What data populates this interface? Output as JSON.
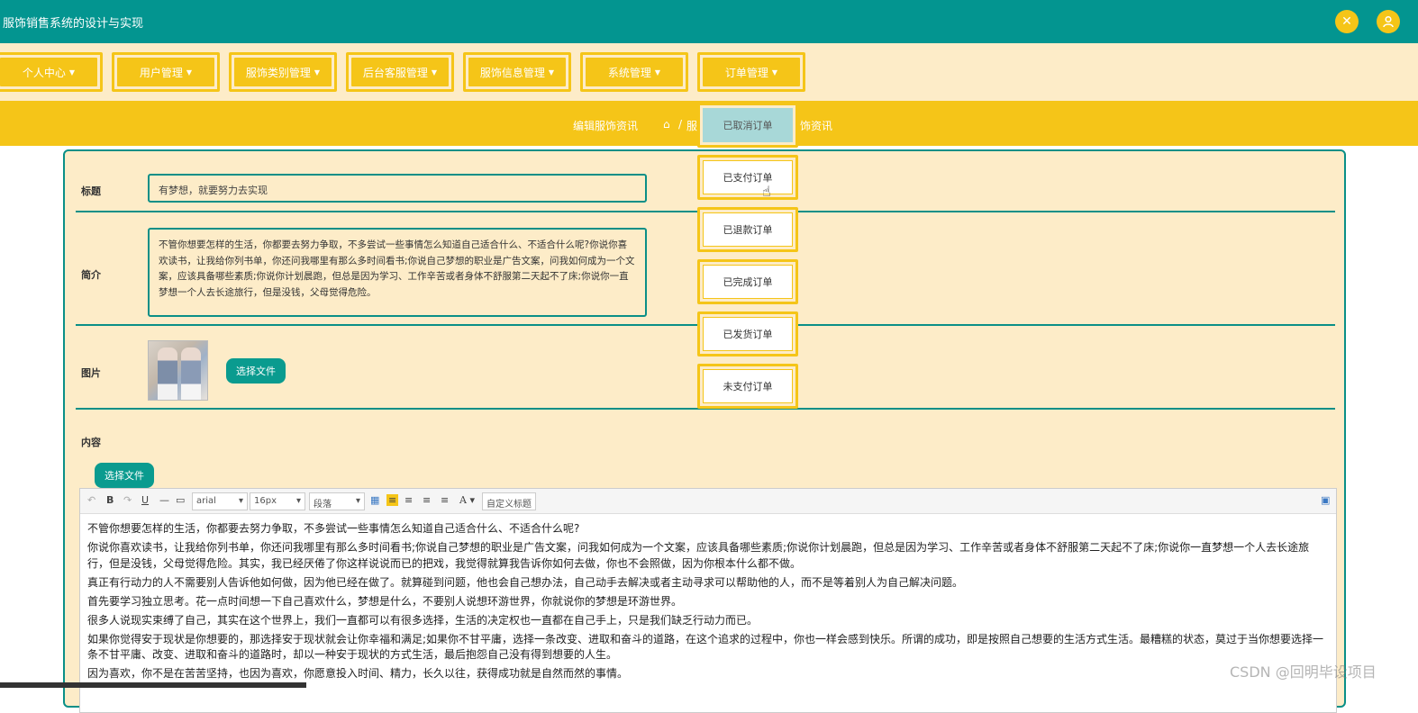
{
  "header": {
    "title": "服饰销售系统的设计与实现",
    "fullscreen_icon": "close-icon",
    "user_icon": "user-icon"
  },
  "nav": {
    "items": [
      {
        "label": "个人中心"
      },
      {
        "label": "用户管理"
      },
      {
        "label": "服饰类别管理"
      },
      {
        "label": "后台客服管理"
      },
      {
        "label": "服饰信息管理"
      },
      {
        "label": "系统管理"
      },
      {
        "label": "订单管理"
      }
    ],
    "order_menu": {
      "items": [
        {
          "label": "已取消订单"
        },
        {
          "label": "已支付订单"
        },
        {
          "label": "已退款订单"
        },
        {
          "label": "已完成订单"
        },
        {
          "label": "已发货订单"
        },
        {
          "label": "未支付订单"
        }
      ]
    }
  },
  "breadcrumb": {
    "page": "编辑服饰资讯",
    "home_icon": "home-icon",
    "sep": "/",
    "path_1": "服",
    "path_2": "饰资讯"
  },
  "form": {
    "title_label": "标题",
    "title_value": "有梦想，就要努力去实现",
    "intro_label": "简介",
    "intro_value": "不管你想要怎样的生活，你都要去努力争取，不多尝试一些事情怎么知道自己适合什么、不适合什么呢?你说你喜欢读书，让我给你列书单，你还问我哪里有那么多时间看书;你说自己梦想的职业是广告文案，问我如何成为一个文案，应该具备哪些素质;你说你计划晨跑，但总是因为学习、工作辛苦或者身体不舒服第二天起不了床;你说你一直梦想一个人去长途旅行，但是没钱，父母觉得危险。",
    "image_label": "图片",
    "choose_file": "选择文件",
    "content_label": "内容",
    "content_choose_file": "选择文件"
  },
  "editor": {
    "font": "arial",
    "size": "16px",
    "para": "段落",
    "custom_title": "自定义标题",
    "paragraphs": [
      "不管你想要怎样的生活，你都要去努力争取，不多尝试一些事情怎么知道自己适合什么、不适合什么呢?",
      "你说你喜欢读书，让我给你列书单，你还问我哪里有那么多时间看书;你说自己梦想的职业是广告文案，问我如何成为一个文案，应该具备哪些素质;你说你计划晨跑，但总是因为学习、工作辛苦或者身体不舒服第二天起不了床;你说你一直梦想一个人去长途旅行，但是没钱，父母觉得危险。其实，我已经厌倦了你这样说说而已的把戏，我觉得就算我告诉你如何去做，你也不会照做，因为你根本什么都不做。",
      "真正有行动力的人不需要别人告诉他如何做，因为他已经在做了。就算碰到问题，他也会自己想办法，自己动手去解决或者主动寻求可以帮助他的人，而不是等着别人为自己解决问题。",
      "首先要学习独立思考。花一点时间想一下自己喜欢什么，梦想是什么，不要别人说想环游世界，你就说你的梦想是环游世界。",
      "很多人说现实束缚了自己，其实在这个世界上，我们一直都可以有很多选择，生活的决定权也一直都在自己手上，只是我们缺乏行动力而已。",
      "如果你觉得安于现状是你想要的，那选择安于现状就会让你幸福和满足;如果你不甘平庸，选择一条改变、进取和奋斗的道路，在这个追求的过程中，你也一样会感到快乐。所谓的成功，即是按照自己想要的生活方式生活。最糟糕的状态，莫过于当你想要选择一条不甘平庸、改变、进取和奋斗的道路时，却以一种安于现状的方式生活，最后抱怨自己没有得到想要的人生。",
      "因为喜欢，你不是在苦苦坚持，也因为喜欢，你愿意投入时间、精力，长久以往，获得成功就是自然而然的事情。"
    ]
  },
  "watermark": "CSDN @回明毕设项目",
  "colors": {
    "teal": "#039590",
    "yellow": "#f5c518",
    "cream": "#fdecc8"
  }
}
